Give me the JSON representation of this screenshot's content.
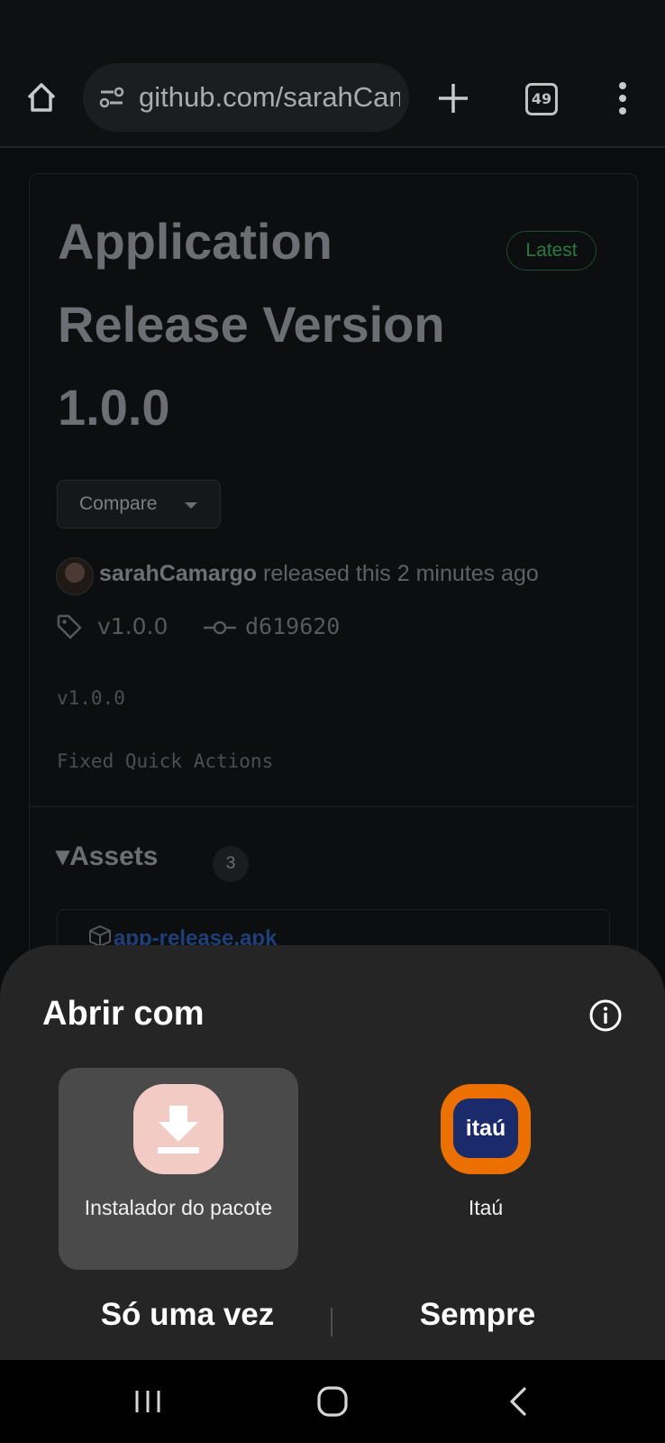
{
  "browser": {
    "url": "github.com/sarahCamargo",
    "tab_count": "49"
  },
  "release": {
    "title": "Application Release Version 1.0.0",
    "badge": "Latest",
    "compare_label": "Compare",
    "author": "sarahCamargo",
    "released_text": " released this 2 minutes ago",
    "tag": "v1.0.0",
    "commit": "d619620",
    "body_version": "v1.0.0",
    "body_note": "Fixed Quick Actions",
    "assets_heading": "Assets",
    "assets_count": "3",
    "first_asset": "app-release.apk"
  },
  "sheet": {
    "title": "Abrir com",
    "apps": [
      {
        "label": "Instalador do pacote",
        "icon": "download-icon",
        "icon_bg": "#f1cbc4",
        "selected": true
      },
      {
        "label": "Itaú",
        "icon": "itau-logo",
        "icon_bg": "#ec7000",
        "selected": false
      }
    ],
    "itau_logo_text": "itaú",
    "just_once": "Só uma vez",
    "always": "Sempre"
  },
  "nav": {
    "recents_icon": "recents-icon",
    "home_icon": "home-circle-icon",
    "back_icon": "back-chevron-icon"
  }
}
